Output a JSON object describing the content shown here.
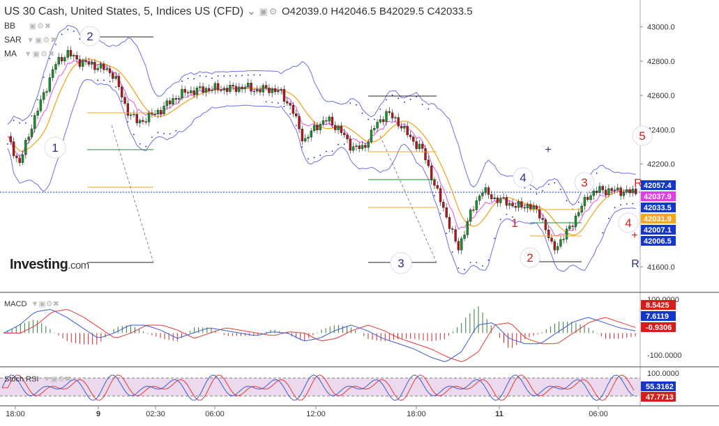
{
  "header": {
    "title": "US 30 Cash, United States, 5, Indices US (CFD)",
    "open": "O42039.0",
    "high": "H42046.5",
    "bid": "B42029.5",
    "close": "C42033.5"
  },
  "indicators": [
    "BB",
    "SAR",
    "MA"
  ],
  "logo": {
    "main": "Investing",
    "suffix": ".com"
  },
  "colors": {
    "up": "#1a8f2a",
    "down": "#b01818",
    "bb": "#6a6ee8",
    "ma_orange": "#f5a623",
    "ma_pink": "#e54fe5",
    "sar": "#1a1aa8",
    "macd": "#3a5bd9",
    "signal": "#e53935",
    "rsi_k": "#3a5bd9",
    "rsi_d": "#e53935",
    "rsi_band": "#e9cfe9"
  },
  "chart_data": [
    {
      "type": "candlestick",
      "ylim": [
        41500,
        43100
      ],
      "y_ticks": [
        "43000.0",
        "42800.0",
        "42600.0",
        "42400.0",
        "42200.0",
        "41600.0"
      ],
      "x_ticks": [
        "18:00",
        "9",
        "02:30",
        "06:00",
        "12:00",
        "18:00",
        "11",
        "06:00"
      ],
      "price_tags": [
        {
          "label": "42057.4",
          "bg": "#1437c8"
        },
        {
          "label": "42037.9",
          "bg": "#e53ee0"
        },
        {
          "label": "42033.5",
          "bg": "#1437c8"
        },
        {
          "label": "42031.9",
          "bg": "#f5a623"
        },
        {
          "label": "42007.1",
          "bg": "#1437c8"
        },
        {
          "label": "42006.5",
          "bg": "#1437c8"
        }
      ],
      "wave_labels": [
        {
          "text": "1",
          "color": "#2b2f8a"
        },
        {
          "text": "2",
          "color": "#2b2f8a"
        },
        {
          "text": "3",
          "color": "#2b2f8a"
        },
        {
          "text": "4",
          "color": "#2b2f8a"
        },
        {
          "text": "5",
          "color": "#d81b1b"
        },
        {
          "text": "1",
          "color": "#d81b1b"
        },
        {
          "text": "2",
          "color": "#d81b1b"
        },
        {
          "text": "3",
          "color": "#d81b1b"
        },
        {
          "text": "4",
          "color": "#d81b1b"
        }
      ],
      "r_markers": [
        {
          "text": "R",
          "color": "#d81b1b"
        },
        {
          "text": "R",
          "color": "#2b2f8a"
        }
      ],
      "close_path": [
        42350,
        42200,
        42420,
        42600,
        42780,
        42850,
        42800,
        42780,
        42760,
        42720,
        42520,
        42440,
        42480,
        42520,
        42580,
        42620,
        42630,
        42640,
        42640,
        42640,
        42650,
        42630,
        42640,
        42620,
        42520,
        42330,
        42420,
        42460,
        42400,
        42300,
        42290,
        42420,
        42500,
        42440,
        42350,
        42280,
        42080,
        41900,
        41700,
        41900,
        42050,
        42000,
        41980,
        41950,
        41960,
        41900,
        41700,
        41780,
        41900,
        42020,
        42050,
        42045,
        42040,
        42033.5
      ]
    },
    {
      "type": "line",
      "name": "MACD",
      "y_ticks": [
        "100.0000",
        "-100.0000"
      ],
      "value_tags": [
        {
          "label": "8.5425",
          "bg": "#d81b1b"
        },
        {
          "label": "7.6119",
          "bg": "#1437c8"
        },
        {
          "label": "-0.9306",
          "bg": "#d81b1b"
        }
      ],
      "macd_path": [
        0,
        30,
        80,
        90,
        60,
        20,
        -20,
        0,
        30,
        30,
        10,
        -20,
        0,
        20,
        10,
        0,
        -10,
        5,
        0,
        -30,
        -20,
        10,
        30,
        10,
        -20,
        -40,
        -60,
        -90,
        -110,
        -70,
        30,
        40,
        -20,
        -40,
        -40,
        0,
        40,
        60,
        40,
        20,
        8.5
      ]
    },
    {
      "type": "line",
      "name": "Stoch RSI",
      "y_ticks": [
        "100.0000"
      ],
      "value_tags": [
        {
          "label": "55.3162",
          "bg": "#1437c8"
        },
        {
          "label": "47.7713",
          "bg": "#d81b1b"
        }
      ]
    }
  ]
}
